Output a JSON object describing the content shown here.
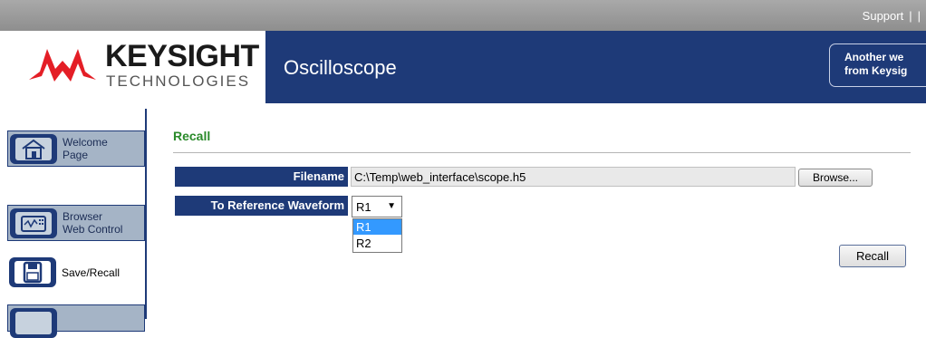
{
  "topbar": {
    "support": "Support",
    "sep1": "|",
    "sep2": "|"
  },
  "header": {
    "logo_word": "KEYSIGHT",
    "logo_sub": "TECHNOLOGIES",
    "app_title": "Oscilloscope",
    "promo_line1": "Another we",
    "promo_line2": "from Keysig"
  },
  "sidebar": {
    "items": [
      {
        "line1": "Welcome",
        "line2": "Page",
        "icon": "home-icon"
      },
      {
        "line1": "Browser",
        "line2": "Web Control",
        "icon": "scope-icon"
      },
      {
        "line1": "Save/Recall",
        "line2": "",
        "icon": "floppy-disk-icon"
      }
    ]
  },
  "main": {
    "section_title": "Recall",
    "filename_label": "Filename",
    "filename_value": "C:\\Temp\\web_interface\\scope.h5",
    "browse_label": "Browse...",
    "ref_label": "To Reference Waveform",
    "ref_selected": "R1",
    "ref_options": [
      "R1",
      "R2"
    ],
    "recall_label": "Recall"
  },
  "colors": {
    "brand_navy": "#1e3a78",
    "title_green": "#2a8a2a",
    "logo_red": "#e41e26",
    "sidebar_tab": "#a5b4c6",
    "option_highlight": "#3399ff"
  }
}
